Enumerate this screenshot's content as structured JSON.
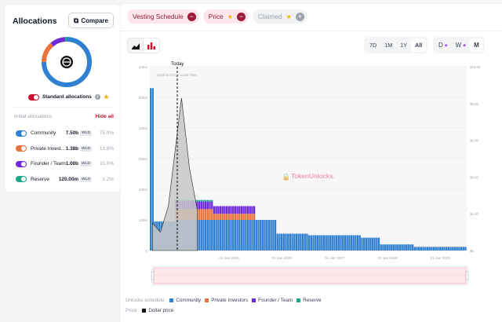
{
  "sidebar": {
    "title": "Allocations",
    "compare_label": "Compare",
    "standard_label": "Standard allocations",
    "initial_title": "Initial allocations",
    "hide_all_label": "Hide all",
    "items": [
      {
        "name": "Community",
        "value": "7.50b",
        "unit": "WLD",
        "pct": "75.0%",
        "color": "#2f80d1"
      },
      {
        "name": "Private Invest...",
        "value": "1.38b",
        "unit": "WLD",
        "pct": "13.8%",
        "color": "#e8743b"
      },
      {
        "name": "Founder / Team",
        "value": "1.00b",
        "unit": "WLD",
        "pct": "10.0%",
        "color": "#6d28d9"
      },
      {
        "name": "Reserve",
        "value": "120.00m",
        "unit": "WLD",
        "pct": "1.2%",
        "color": "#21a68d"
      }
    ]
  },
  "filters": [
    {
      "label": "Vesting Schedule",
      "active": true
    },
    {
      "label": "Price",
      "active": true
    },
    {
      "label": "Claimed",
      "active": false
    }
  ],
  "time_ranges": [
    "7D",
    "1M",
    "1Y",
    "All"
  ],
  "active_range": "All",
  "granularity": [
    "D",
    "W",
    "M"
  ],
  "active_granularity": "M",
  "chart": {
    "today_label": "Today",
    "note": "Chart in UTC + Local Time",
    "watermark": "TokenUnlocks.",
    "y_left_ticks": [
      "0",
      "100m",
      "200m",
      "300m",
      "400m",
      "500m",
      "600m"
    ],
    "y_right_ticks": [
      "$0",
      "$2.00",
      "$4.00",
      "$6.00",
      "$8.00",
      "$10.00"
    ],
    "x_ticks": [
      "01 Jan 2025",
      "01 Jan 2026",
      "01 Jan 2027",
      "01 Jan 2028",
      "01 Jan 2029"
    ]
  },
  "legend": {
    "unlocks_title": "Unlocks schedule",
    "price_title": "Price",
    "price_item": "Dollar price"
  },
  "colors": {
    "community": "#2f80d1",
    "private": "#e8743b",
    "founder": "#6d28d9",
    "reserve": "#21a68d",
    "accent": "#c8102e"
  },
  "chart_data": {
    "type": "bar",
    "x_range": [
      "2023-07",
      "2029-07"
    ],
    "y_left_range": [
      0,
      600000000
    ],
    "y_right_range": [
      0,
      10
    ],
    "series": [
      {
        "name": "Community",
        "values": [
          [
            0.0,
            530
          ],
          [
            0.05,
            95
          ],
          [
            0.45,
            100
          ],
          [
            2.4,
            55
          ],
          [
            3.0,
            50
          ],
          [
            4.0,
            42
          ],
          [
            4.35,
            20
          ],
          [
            5.0,
            12
          ],
          [
            6.0,
            12
          ]
        ]
      },
      {
        "name": "Private Investors",
        "values": [
          [
            0.45,
            35
          ],
          [
            1.2,
            20
          ],
          [
            2.0,
            0
          ]
        ]
      },
      {
        "name": "Founder / Team",
        "values": [
          [
            0.45,
            25
          ],
          [
            1.2,
            25
          ],
          [
            2.0,
            0
          ]
        ]
      },
      {
        "name": "Reserve",
        "values": [
          [
            0.45,
            5
          ],
          [
            1.2,
            0
          ]
        ]
      },
      {
        "name": "Dollar price",
        "values": [
          [
            0.05,
            1.5
          ],
          [
            0.2,
            1.0
          ],
          [
            0.35,
            2.4
          ],
          [
            0.6,
            8.3
          ],
          [
            0.75,
            4.5
          ],
          [
            0.9,
            2.2
          ]
        ]
      }
    ]
  }
}
